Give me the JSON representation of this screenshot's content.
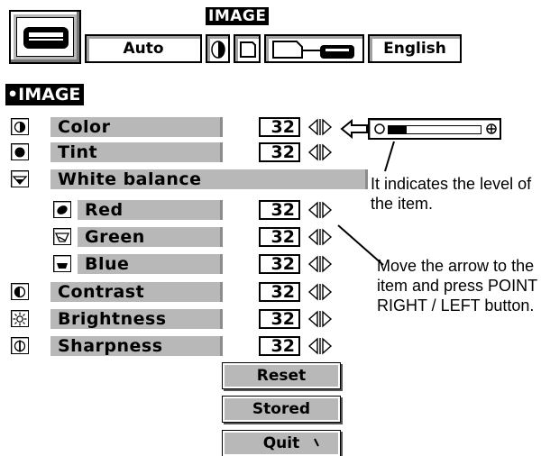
{
  "toolbar": {
    "title": "IMAGE",
    "mode_label": "Auto",
    "language_label": "English"
  },
  "menu": {
    "title": "•IMAGE",
    "rows": [
      {
        "label": "Color",
        "value": "32",
        "icon": "color-icon"
      },
      {
        "label": "Tint",
        "value": "32",
        "icon": "tint-icon"
      },
      {
        "label": "White balance",
        "icon": "white-balance-icon"
      },
      {
        "label": "Red",
        "value": "32",
        "icon": "red-icon"
      },
      {
        "label": "Green",
        "value": "32",
        "icon": "green-icon"
      },
      {
        "label": "Blue",
        "value": "32",
        "icon": "blue-icon"
      },
      {
        "label": "Contrast",
        "value": "32",
        "icon": "contrast-icon"
      },
      {
        "label": "Brightness",
        "value": "32",
        "icon": "brightness-icon"
      },
      {
        "label": "Sharpness",
        "value": "32",
        "icon": "sharpness-icon"
      }
    ],
    "buttons": {
      "reset": "Reset",
      "stored": "Stored",
      "quit": "Quit"
    }
  },
  "level_indicator": {
    "fill": 0.2
  },
  "annotations": {
    "level": "It indicates the level of the item.",
    "arrow": "Move the arrow to the item and press POINT RIGHT / LEFT button."
  }
}
